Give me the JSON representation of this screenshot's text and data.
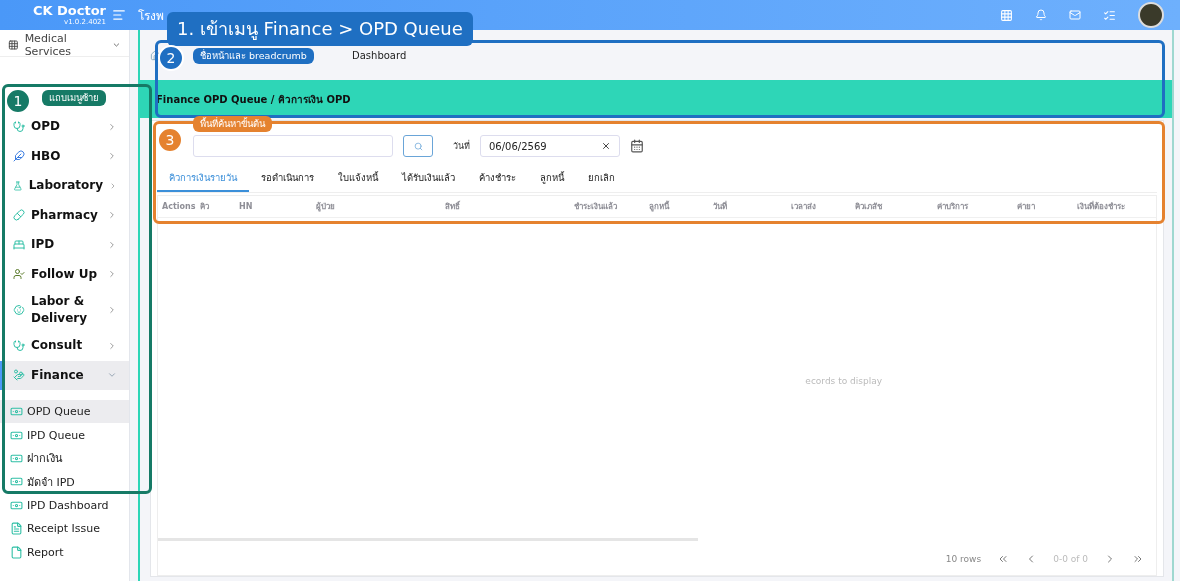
{
  "topbar": {
    "brand": "CK Doctor",
    "version": "v1.0.2.4021",
    "hospital": "โรงพ"
  },
  "sidebar": {
    "module": "Medical Services",
    "items": [
      {
        "kind": "group",
        "label": "OPD",
        "expanded": false
      },
      {
        "kind": "group",
        "label": "HBO",
        "expanded": false
      },
      {
        "kind": "group",
        "label": "Laboratory",
        "expanded": false
      },
      {
        "kind": "group",
        "label": "Pharmacy",
        "expanded": false
      },
      {
        "kind": "group",
        "label": "IPD",
        "expanded": false
      },
      {
        "kind": "group",
        "label": "Follow Up",
        "expanded": false
      },
      {
        "kind": "group",
        "label": "Labor & Delivery",
        "expanded": false
      },
      {
        "kind": "group",
        "label": "Consult",
        "expanded": false
      },
      {
        "kind": "group",
        "label": "Finance",
        "expanded": true,
        "children": [
          {
            "label": "OPD Queue",
            "selected": true
          },
          {
            "label": "IPD Queue",
            "selected": false
          },
          {
            "label": "ฝากเงิน",
            "selected": false
          },
          {
            "label": "มัดจำ IPD",
            "selected": false
          },
          {
            "label": "IPD Dashboard",
            "selected": false
          },
          {
            "label": "Receipt Issue",
            "selected": false
          },
          {
            "label": "Report",
            "selected": false
          }
        ]
      }
    ]
  },
  "breadcrumb": {
    "current": "Dashboard"
  },
  "page_title": "Finance OPD Queue / คิวการเงิน OPD",
  "search": {
    "date_label": "วันที่",
    "date_value": "06/06/2569"
  },
  "tabs": [
    {
      "label": "คิวการเงินรายวัน",
      "selected": true
    },
    {
      "label": "รอดำเนินการ",
      "selected": false
    },
    {
      "label": "ใบแจ้งหนี้",
      "selected": false
    },
    {
      "label": "ได้รับเงินแล้ว",
      "selected": false
    },
    {
      "label": "ค้างชำระ",
      "selected": false
    },
    {
      "label": "ลูกหนี้",
      "selected": false
    },
    {
      "label": "ยกเลิก",
      "selected": false
    }
  ],
  "table": {
    "columns": [
      "Actions",
      "คิว",
      "HN",
      "ผู้ป่วย",
      "สิทธิ์",
      "ชำระเงินแล้ว",
      "ลูกหนี้",
      "วันที่",
      "เวลาส่ง",
      "คิวเภสัช",
      "ค่าบริการ",
      "ค่ายา",
      "เงินที่ต้องชำระ"
    ],
    "empty_message": "ecords to display"
  },
  "pagination": {
    "rows": "10 rows",
    "range": "0-0 of 0"
  },
  "annotations": [
    {
      "kind": "title",
      "text": "1. เข้าเมนู Finance > OPD Queue",
      "color": "#1f6fc2"
    },
    {
      "kind": "region",
      "number": "1",
      "label": "แถบเมนูซ้าย",
      "color": "#167a66"
    },
    {
      "kind": "region",
      "number": "2",
      "label": "ชื่อหน้าและ breadcrumb",
      "color": "#1f6fc2"
    },
    {
      "kind": "region",
      "number": "3",
      "label": "พื้นที่ค้นหาขั้นต้น",
      "color": "#e5822f"
    }
  ]
}
